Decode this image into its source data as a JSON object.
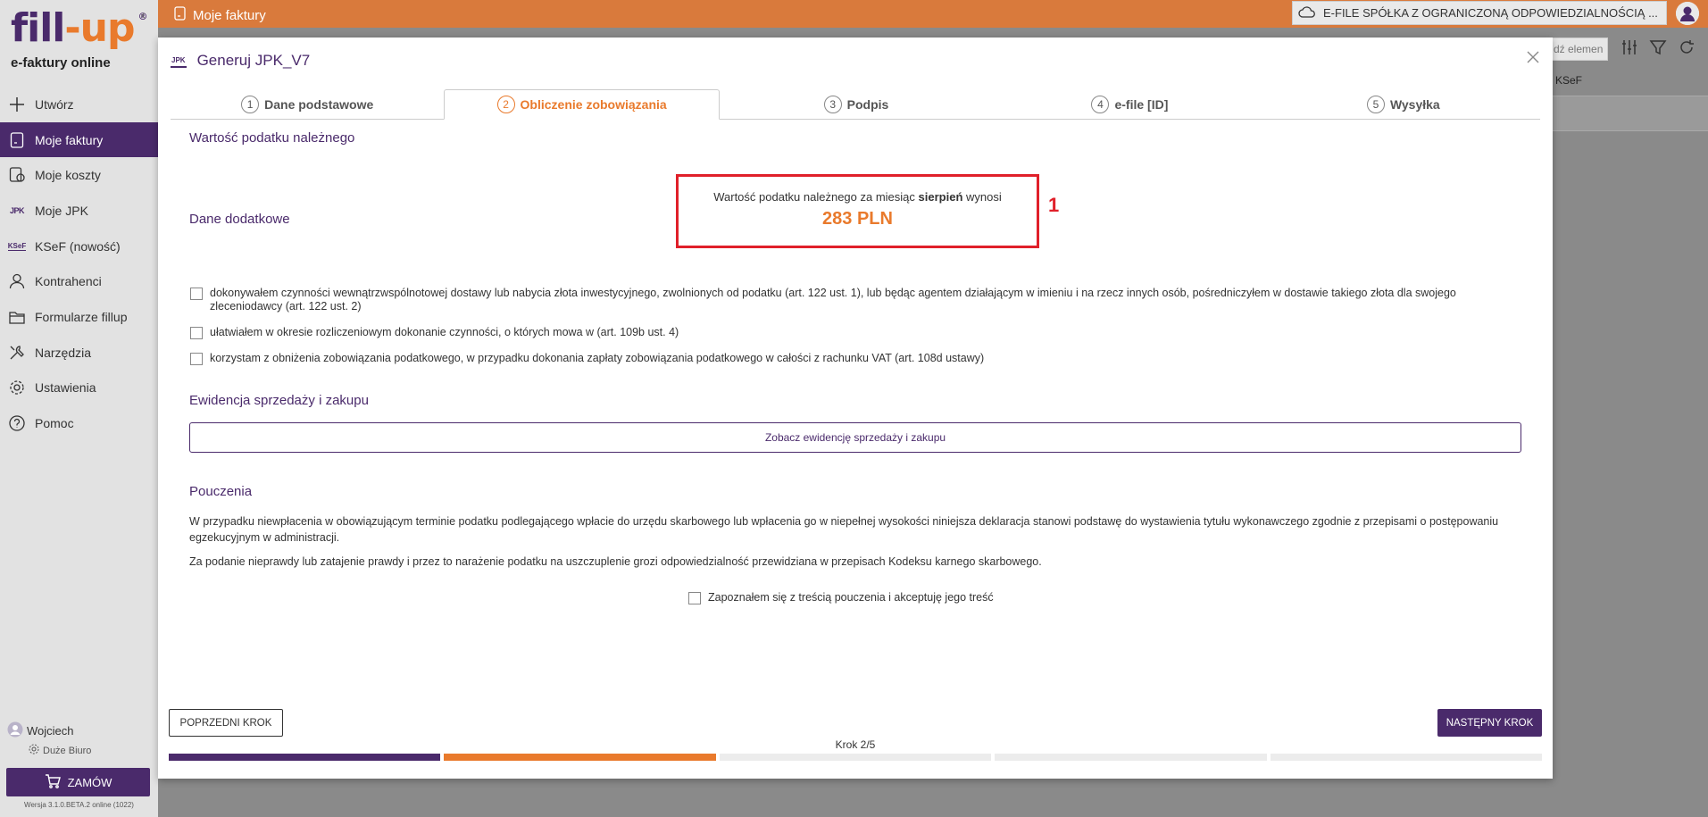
{
  "sidebar": {
    "logo": {
      "fill": "fill",
      "dash": "-",
      "up": "up",
      "reg": "®"
    },
    "collapse": "‹",
    "tagline": "e-faktury online",
    "items": [
      {
        "label": "Utwórz",
        "icon": "plus-icon"
      },
      {
        "label": "Moje faktury",
        "icon": "invoice-icon",
        "active": true
      },
      {
        "label": "Moje koszty",
        "icon": "costs-icon"
      },
      {
        "label": "Moje JPK",
        "icon": "jpk-icon"
      },
      {
        "label": "KSeF (nowość)",
        "icon": "ksef-icon"
      },
      {
        "label": "Kontrahenci",
        "icon": "person-icon"
      },
      {
        "label": "Formularze fillup",
        "icon": "folder-icon"
      },
      {
        "label": "Narzędzia",
        "icon": "tools-icon"
      },
      {
        "label": "Ustawienia",
        "icon": "gear-icon"
      },
      {
        "label": "Pomoc",
        "icon": "help-icon"
      }
    ],
    "jpk_mini": "JPK",
    "ksef_mini": "KSeF",
    "user": {
      "name": "Wojciech",
      "plan": "Duże Biuro"
    },
    "order_label": "ZAMÓW",
    "version": "Wersja 3.1.0.BETA.2 online (1022)"
  },
  "topbar": {
    "title": "Moje faktury",
    "company": "E-FILE SPÓŁKA Z OGRANICZONĄ ODPOWIEDZIALNOŚCIĄ ..."
  },
  "background": {
    "search_placeholder": "dź elemen",
    "column_ksef": "KSeF"
  },
  "modal": {
    "badge": "JPK",
    "title": "Generuj JPK_V7",
    "tabs": [
      {
        "num": "1",
        "label": "Dane podstawowe"
      },
      {
        "num": "2",
        "label": "Obliczenie zobowiązania",
        "active": true
      },
      {
        "num": "3",
        "label": "Podpis"
      },
      {
        "num": "4",
        "label": "e-file [ID]"
      },
      {
        "num": "5",
        "label": "Wysyłka"
      }
    ],
    "tax_section_title": "Wartość podatku należnego",
    "tax_line_prefix": "Wartość podatku należnego za miesiąc",
    "tax_month": "sierpień",
    "tax_line_suffix": "wynosi",
    "tax_amount": "283 PLN",
    "marker": "1",
    "extra_section_title": "Dane dodatkowe",
    "checkboxes": [
      "dokonywałem czynności wewnątrzwspólnotowej dostawy lub nabycia złota inwestycyjnego, zwolnionych od podatku (art. 122 ust. 1), lub będąc agentem działającym w imieniu i na rzecz innych osób, pośredniczyłem w dostawie takiego złota dla swojego zleceniodawcy (art. 122 ust. 2)",
      "ułatwiałem w okresie rozliczeniowym dokonanie czynności, o których mowa w (art. 109b ust. 4)",
      "korzystam z obniżenia zobowiązania podatkowego, w przypadku dokonania zapłaty zobowiązania podatkowego w całości z rachunku VAT (art. 108d ustawy)"
    ],
    "records_section_title": "Ewidencja sprzedaży i zakupu",
    "records_button": "Zobacz ewidencję sprzedaży i zakupu",
    "instructions_title": "Pouczenia",
    "instructions_para1": "W przypadku niewpłacenia w obowiązującym terminie podatku podlegającego wpłacie do urzędu skarbowego lub wpłacenia go w niepełnej wysokości niniejsza deklaracja stanowi podstawę do wystawienia tytułu wykonawczego zgodnie z przepisami o postępowaniu egzekucyjnym w administracji.",
    "instructions_para2": "Za podanie nieprawdy lub zatajenie prawdy i przez to narażenie podatku na uszczuplenie grozi odpowiedzialność przewidziana w przepisach Kodeksu karnego skarbowego.",
    "accept_label": "Zapoznałem się z treścią pouczenia i akceptuję jego treść",
    "prev_button": "POPRZEDNI KROK",
    "next_button": "NASTĘPNY KROK",
    "step_label": "Krok 2/5",
    "progress": {
      "total": 5,
      "current": 2
    }
  },
  "colors": {
    "brand_purple": "#4a2a6b",
    "brand_orange": "#e97a2c",
    "highlight_red": "#e0202a"
  }
}
